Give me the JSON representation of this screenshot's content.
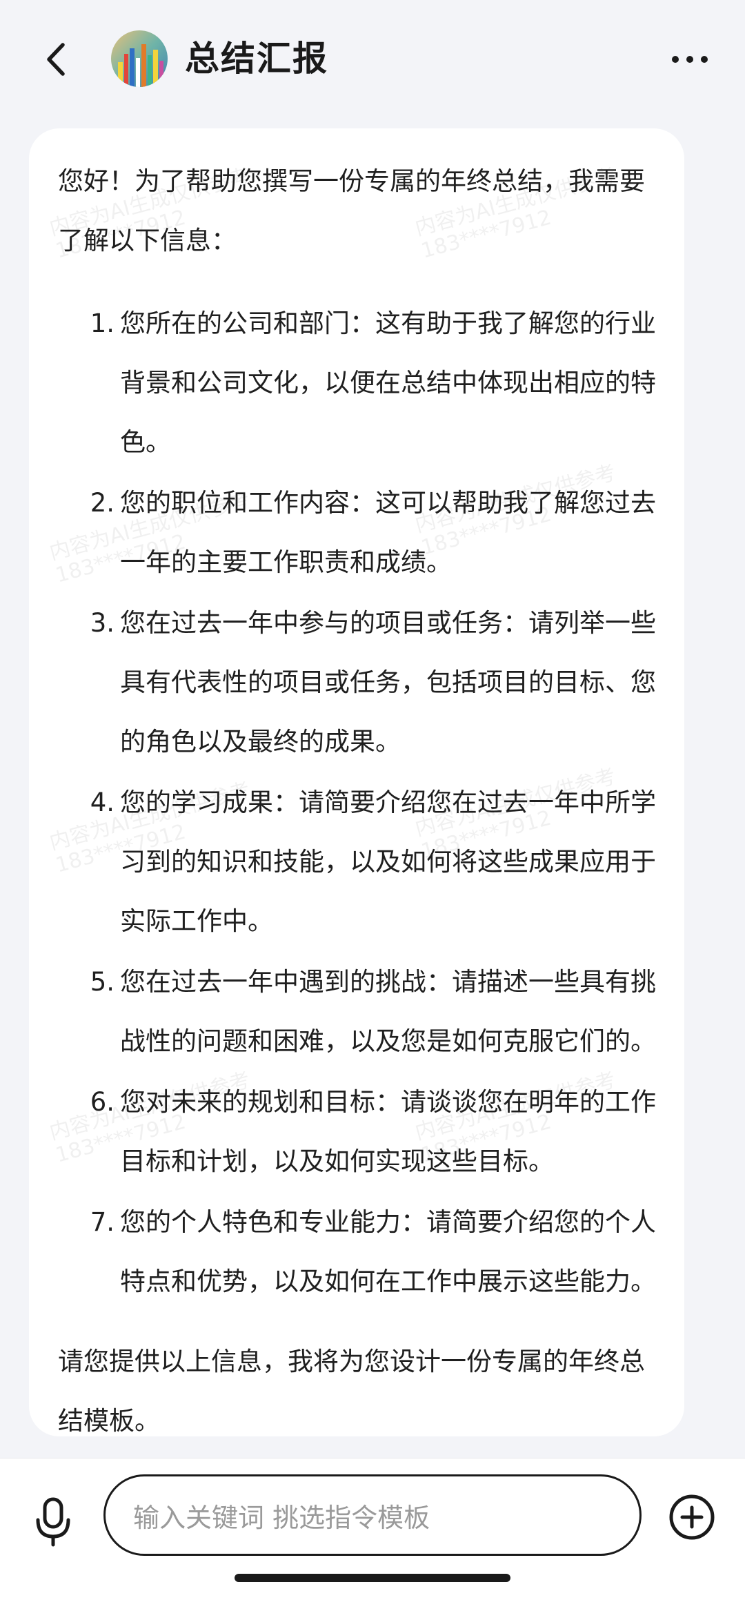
{
  "header": {
    "title": "总结汇报",
    "back_icon": "chevron-left-icon",
    "more_icon": "more-horizontal-icon"
  },
  "message": {
    "intro": "您好！为了帮助您撰写一份专属的年终总结，我需要了解以下信息：",
    "items": [
      {
        "num": "1.",
        "text": "您所在的公司和部门：这有助于我了解您的行业背景和公司文化，以便在总结中体现出相应的特色。"
      },
      {
        "num": "2.",
        "text": "您的职位和工作内容：这可以帮助我了解您过去一年的主要工作职责和成绩。"
      },
      {
        "num": "3.",
        "text": "您在过去一年中参与的项目或任务：请列举一些具有代表性的项目或任务，包括项目的目标、您的角色以及最终的成果。"
      },
      {
        "num": "4.",
        "text": "您的学习成果：请简要介绍您在过去一年中所学习到的知识和技能，以及如何将这些成果应用于实际工作中。"
      },
      {
        "num": "5.",
        "text": "您在过去一年中遇到的挑战：请描述一些具有挑战性的问题和困难，以及您是如何克服它们的。"
      },
      {
        "num": "6.",
        "text": "您对未来的规划和目标：请谈谈您在明年的工作目标和计划，以及如何实现这些目标。"
      },
      {
        "num": "7.",
        "text": "您的个人特色和专业能力：请简要介绍您的个人特点和优势，以及如何在工作中展示这些能力。"
      }
    ],
    "outro": "请您提供以上信息，我将为您设计一份专属的年终总结模板。",
    "watermark": "内容为AI生成仅供参考\n183****7912"
  },
  "input_bar": {
    "placeholder": "输入关键词 挑选指令模板",
    "mic_icon": "microphone-icon",
    "add_icon": "plus-circle-icon"
  }
}
